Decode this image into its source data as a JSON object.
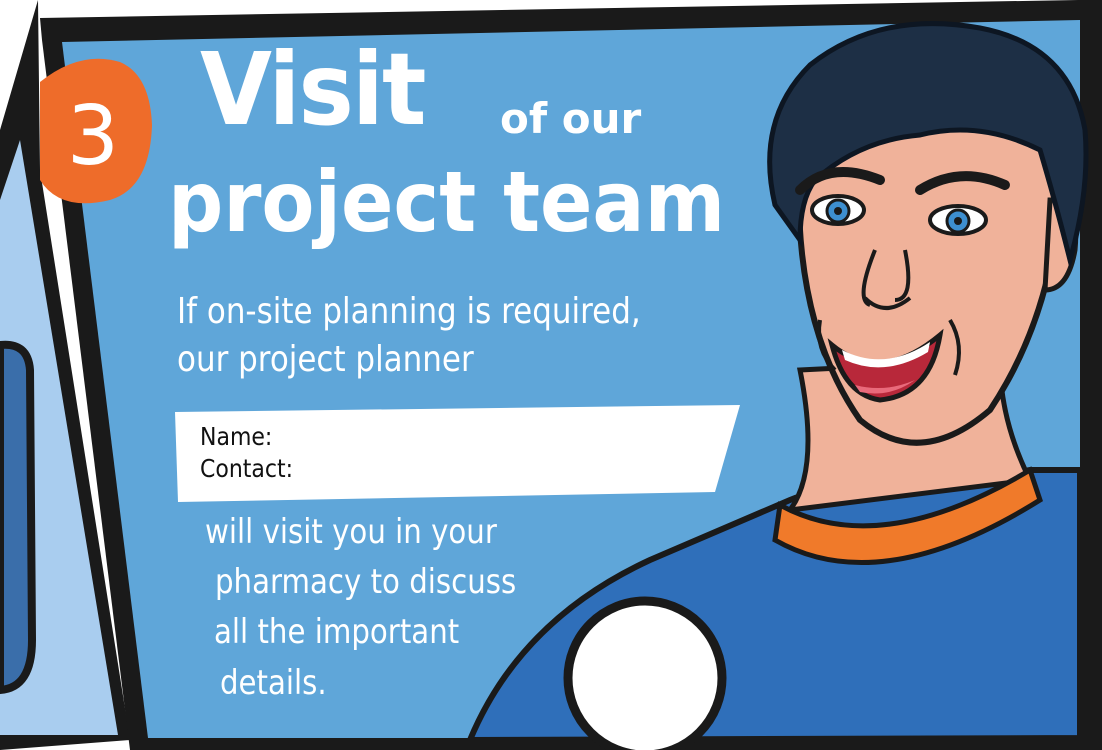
{
  "step": {
    "number": "3"
  },
  "title": {
    "word": "Visit",
    "suffix": "of our",
    "line2": "project team"
  },
  "intro": {
    "line1": "If on-site planning is required,",
    "line2": "our project planner"
  },
  "form": {
    "name_label": "Name:",
    "contact_label": "Contact:"
  },
  "body": {
    "line1": "will visit you in your",
    "line2": "pharmacy to discuss",
    "line3": "all the important",
    "line4": "details."
  },
  "colors": {
    "panel_blue": "#5fa6d9",
    "left_panel_blue": "#a9cdef",
    "badge_orange": "#ee6c2a",
    "shirt_blue": "#2f6fba",
    "collar_orange": "#f07a2a",
    "skin": "#f0b29a",
    "hair": "#1d2f45"
  }
}
